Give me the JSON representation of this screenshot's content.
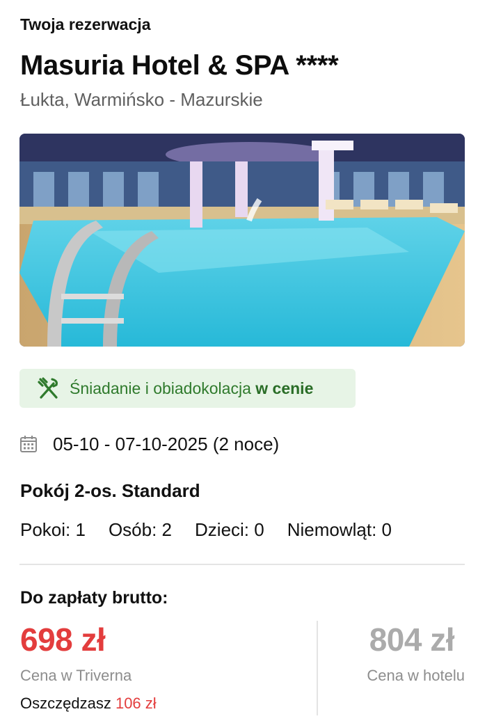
{
  "header": {
    "eyebrow": "Twoja rezerwacja",
    "hotel_name": "Masuria Hotel & SPA ****",
    "location": "Łukta, Warmińsko - Mazurskie"
  },
  "photo": {
    "alt": "Hotel indoor swimming pool"
  },
  "meal": {
    "icon": "fork-knife-icon",
    "text": "Śniadanie i obiadokolacja",
    "emphasis": "w cenie",
    "color": "#2f7a2c",
    "background": "#e7f4e6"
  },
  "stay": {
    "icon": "calendar-icon",
    "dates": "05-10 - 07-10-2025 (2 noce)"
  },
  "room": {
    "name": "Pokój 2-os. Standard",
    "rooms": "Pokoi: 1",
    "persons": "Osób: 2",
    "children": "Dzieci: 0",
    "infants": "Niemowląt: 0"
  },
  "payment": {
    "title": "Do zapłaty brutto:",
    "our_price": "698 zł",
    "our_price_label": "Cena w Triverna",
    "savings_label": "Oszczędzasz",
    "savings_amount": "106 zł",
    "hotel_price": "804 zł",
    "hotel_price_label": "Cena w hotelu",
    "accent_color": "#e33d3d"
  }
}
